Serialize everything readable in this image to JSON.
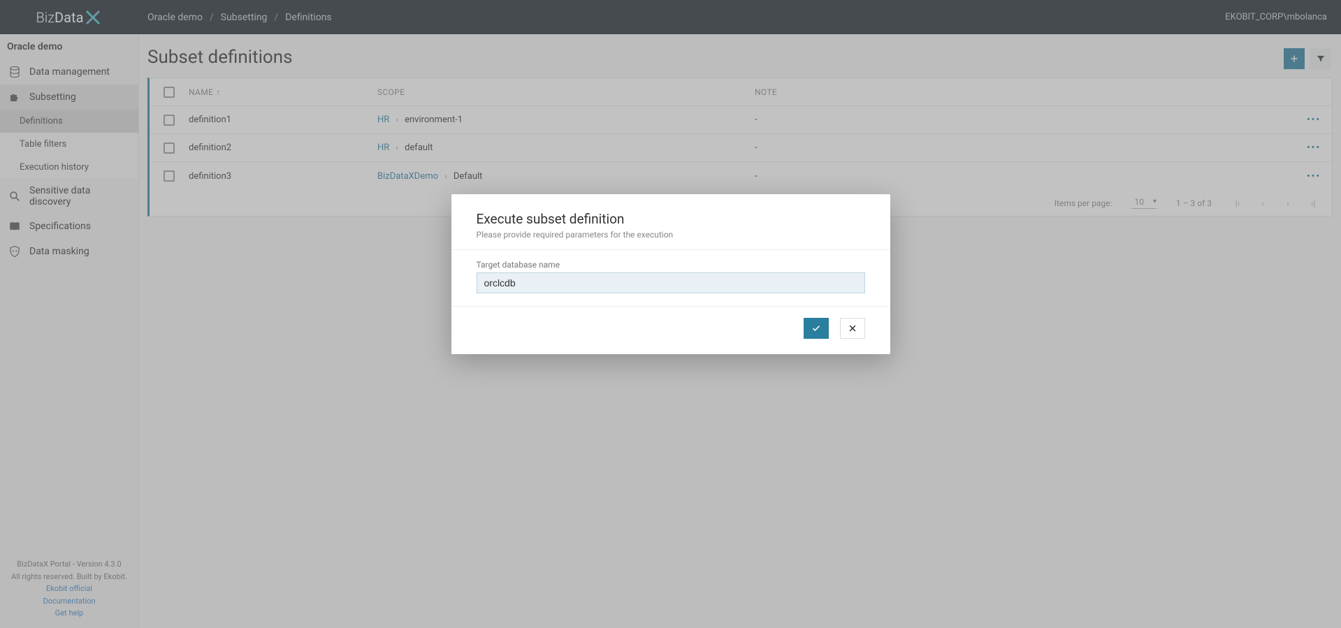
{
  "header": {
    "logo_prefix": "Biz",
    "logo_suffix": "Data",
    "user": "EKOBIT_CORP\\mbolanca",
    "breadcrumb": [
      "Oracle demo",
      "Subsetting",
      "Definitions"
    ]
  },
  "sidebar": {
    "project": "Oracle demo",
    "items": [
      {
        "label": "Data management"
      },
      {
        "label": "Subsetting",
        "children": [
          {
            "label": "Definitions"
          },
          {
            "label": "Table filters"
          },
          {
            "label": "Execution history"
          }
        ]
      },
      {
        "label": "Sensitive data discovery"
      },
      {
        "label": "Specifications"
      },
      {
        "label": "Data masking"
      }
    ],
    "footer": {
      "line1": "BizDataX Portal - Version 4.3.0",
      "line2": "All rights reserved. Built by Ekobit.",
      "links": [
        "Ekobit official",
        "Documentation",
        "Get help"
      ]
    }
  },
  "page": {
    "title": "Subset definitions",
    "columns": [
      "NAME",
      "SCOPE",
      "NOTE"
    ],
    "rows": [
      {
        "name": "definition1",
        "scope_primary": "HR",
        "scope_secondary": "environment-1",
        "note": "-"
      },
      {
        "name": "definition2",
        "scope_primary": "HR",
        "scope_secondary": "default",
        "note": "-"
      },
      {
        "name": "definition3",
        "scope_primary": "BizDataXDemo",
        "scope_secondary": "Default",
        "note": "-"
      }
    ],
    "paginator": {
      "items_per_page_label": "Items per page:",
      "items_per_page_value": "10",
      "range_label": "1 – 3 of 3"
    }
  },
  "modal": {
    "title": "Execute subset definition",
    "subtitle": "Please provide required parameters for the execution",
    "field_label": "Target database name",
    "field_value": "orclcdb"
  }
}
